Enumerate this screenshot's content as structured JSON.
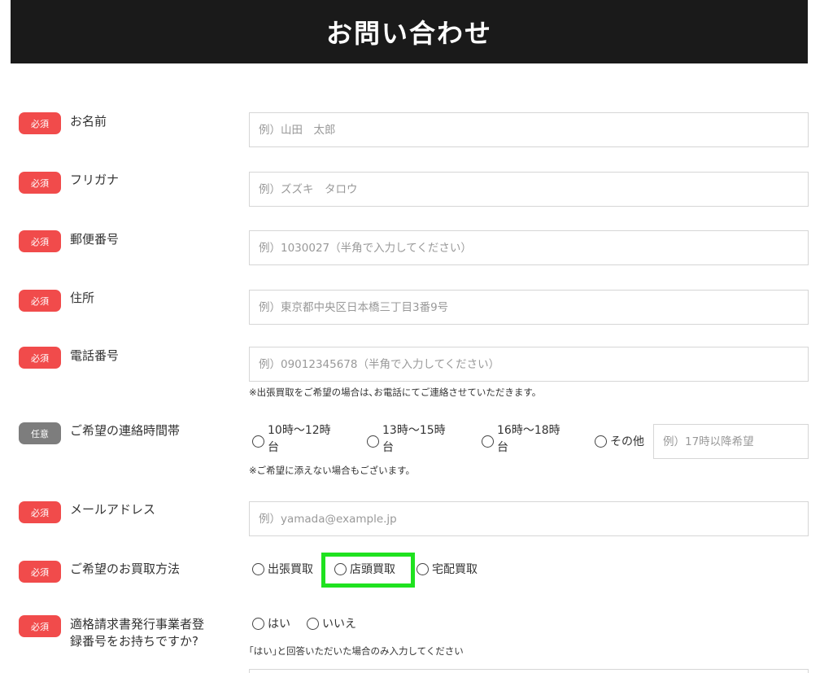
{
  "header": {
    "title": "お問い合わせ"
  },
  "fields": {
    "name": {
      "badge": "必須",
      "label": "お名前",
      "placeholder": "例）山田　太郎"
    },
    "furigana": {
      "badge": "必須",
      "label": "フリガナ",
      "placeholder": "例）ズズキ　タロウ"
    },
    "postal": {
      "badge": "必須",
      "label": "郵便番号",
      "placeholder": "例）1030027（半角で入力してください）"
    },
    "address": {
      "badge": "必須",
      "label": "住所",
      "placeholder": "例）東京都中央区日本橋三丁目3番9号"
    },
    "phone": {
      "badge": "必須",
      "label": "電話番号",
      "placeholder": "例）09012345678（半角で入力してください）",
      "note": "※出張買取をご希望の場合は､お電話にてご連絡させていただきます。"
    },
    "contact_time": {
      "badge": "任意",
      "label": "ご希望の連絡時間帯",
      "options": [
        "10時〜12時台",
        "13時〜15時台",
        "16時〜18時台",
        "その他"
      ],
      "other_placeholder": "例）17時以降希望",
      "note": "※ご希望に添えない場合もございます。"
    },
    "email": {
      "badge": "必須",
      "label": "メールアドレス",
      "placeholder": "例）yamada@example.jp"
    },
    "purchase_method": {
      "badge": "必須",
      "label": "ご希望のお買取方法",
      "options": [
        "出張買取",
        "店頭買取",
        "宅配買取"
      ]
    },
    "invoice": {
      "badge": "必須",
      "label_line1": "適格請求書発行事業者登",
      "label_line2": "録番号をお持ちですか?",
      "options": [
        "はい",
        "いいえ"
      ],
      "note": "｢はい｣と回答いただいた場合のみ入力してください"
    }
  },
  "colors": {
    "header_bg": "#1a1a1a",
    "required_badge": "#f14b4b",
    "optional_badge": "#7d7d7d",
    "highlight": "#1fe21f"
  }
}
